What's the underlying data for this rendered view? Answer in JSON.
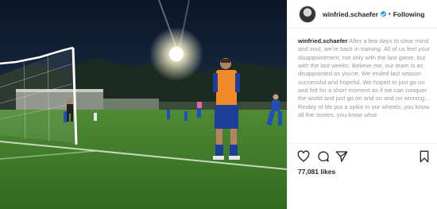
{
  "post": {
    "username": "winfried.schaefer",
    "separator": "•",
    "follow_label": "Following",
    "caption_username": "winfried.schaefer",
    "caption_text": "After a few days to clear mind and soul, we're back in training. All of us feel your disappointment, not only with the last game, but with the last weeks. Believe me, our team is as disappointed as you're. We ended last season successful and hopeful. We hoped to just go on and felt for a short moment as if we can conquer the world and just go on and on and on winning... Reality of life put a spike in our wheels, you know all the stories, you know what",
    "likes": "77,081 likes",
    "icons": [
      "verified-icon",
      "heart-icon",
      "comment-icon",
      "share-icon",
      "bookmark-icon"
    ],
    "colors": {
      "verified": "#3897f0",
      "text": "#262626",
      "muted": "#999999",
      "pitch": "#3f7a2a",
      "sky": "#0e1a2a",
      "bib": "#f08a2a",
      "shorts": "#1e3f99"
    }
  }
}
